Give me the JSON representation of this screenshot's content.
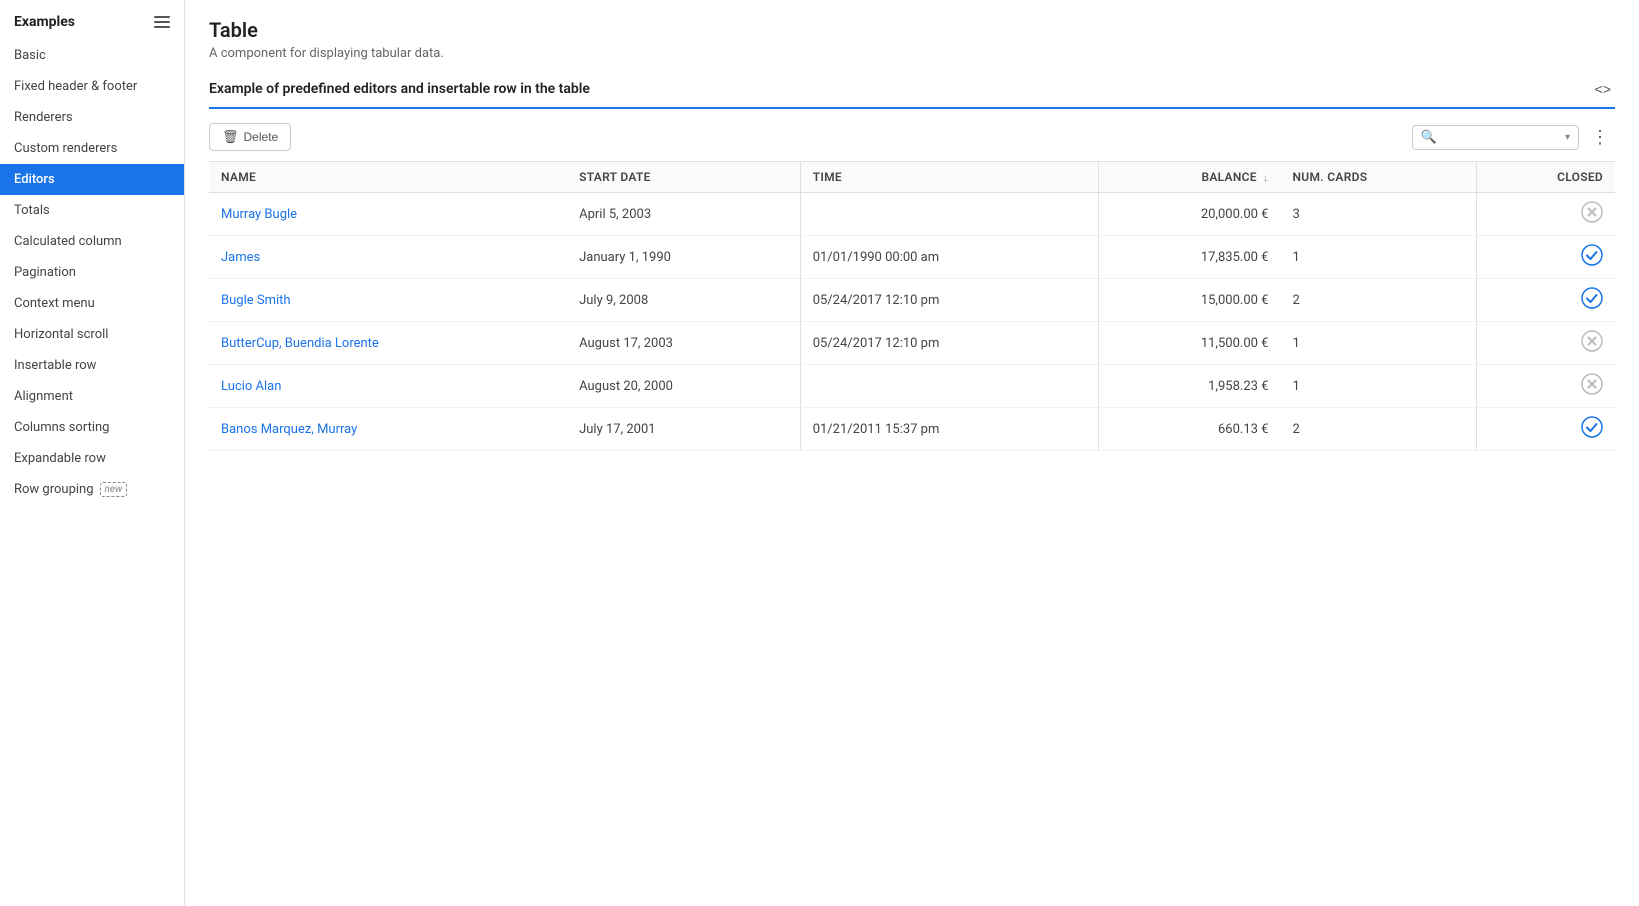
{
  "sidebar": {
    "title": "Examples",
    "items": [
      {
        "id": "basic",
        "label": "Basic",
        "active": false,
        "badge": null
      },
      {
        "id": "fixed-header-footer",
        "label": "Fixed header & footer",
        "active": false,
        "badge": null
      },
      {
        "id": "renderers",
        "label": "Renderers",
        "active": false,
        "badge": null
      },
      {
        "id": "custom-renderers",
        "label": "Custom renderers",
        "active": false,
        "badge": null
      },
      {
        "id": "editors",
        "label": "Editors",
        "active": true,
        "badge": null
      },
      {
        "id": "totals",
        "label": "Totals",
        "active": false,
        "badge": null
      },
      {
        "id": "calculated-column",
        "label": "Calculated column",
        "active": false,
        "badge": null
      },
      {
        "id": "pagination",
        "label": "Pagination",
        "active": false,
        "badge": null
      },
      {
        "id": "context-menu",
        "label": "Context menu",
        "active": false,
        "badge": null
      },
      {
        "id": "horizontal-scroll",
        "label": "Horizontal scroll",
        "active": false,
        "badge": null
      },
      {
        "id": "insertable-row",
        "label": "Insertable row",
        "active": false,
        "badge": null
      },
      {
        "id": "alignment",
        "label": "Alignment",
        "active": false,
        "badge": null
      },
      {
        "id": "columns-sorting",
        "label": "Columns sorting",
        "active": false,
        "badge": null
      },
      {
        "id": "expandable-row",
        "label": "Expandable row",
        "active": false,
        "badge": null
      },
      {
        "id": "row-grouping",
        "label": "Row grouping",
        "active": false,
        "badge": "new"
      }
    ]
  },
  "page": {
    "title": "Table",
    "subtitle": "A component for displaying tabular data."
  },
  "section": {
    "title": "Example of predefined editors and insertable row in the table"
  },
  "toolbar": {
    "delete_label": "Delete",
    "search_placeholder": "",
    "more_icon": "⋮"
  },
  "table": {
    "columns": [
      {
        "id": "name",
        "label": "Name",
        "sortable": false
      },
      {
        "id": "start_date",
        "label": "Start date",
        "sortable": false
      },
      {
        "id": "time",
        "label": "TIME",
        "sortable": false
      },
      {
        "id": "balance",
        "label": "Balance",
        "sortable": true,
        "align": "right"
      },
      {
        "id": "num_cards",
        "label": "Num. Cards",
        "sortable": false
      },
      {
        "id": "closed",
        "label": "Closed",
        "sortable": false,
        "align": "right"
      }
    ],
    "rows": [
      {
        "name": "Murray Bugle",
        "start_date": "April 5, 2003",
        "time": "",
        "balance": "20,000.00 €",
        "num_cards": "3",
        "closed": "cross"
      },
      {
        "name": "James",
        "start_date": "January 1, 1990",
        "time": "01/01/1990 00:00 am",
        "balance": "17,835.00 €",
        "num_cards": "1",
        "closed": "check"
      },
      {
        "name": "Bugle Smith",
        "start_date": "July 9, 2008",
        "time": "05/24/2017 12:10 pm",
        "balance": "15,000.00 €",
        "num_cards": "2",
        "closed": "check"
      },
      {
        "name": "ButterCup, Buendia Lorente",
        "start_date": "August 17, 2003",
        "time": "05/24/2017 12:10 pm",
        "balance": "11,500.00 €",
        "num_cards": "1",
        "closed": "cross"
      },
      {
        "name": "Lucio Alan",
        "start_date": "August 20, 2000",
        "time": "",
        "balance": "1,958.23 €",
        "num_cards": "1",
        "closed": "cross"
      },
      {
        "name": "Banos Marquez, Murray",
        "start_date": "July 17, 2001",
        "time": "01/21/2011 15:37 pm",
        "balance": "660.13 €",
        "num_cards": "2",
        "closed": "check"
      }
    ]
  }
}
